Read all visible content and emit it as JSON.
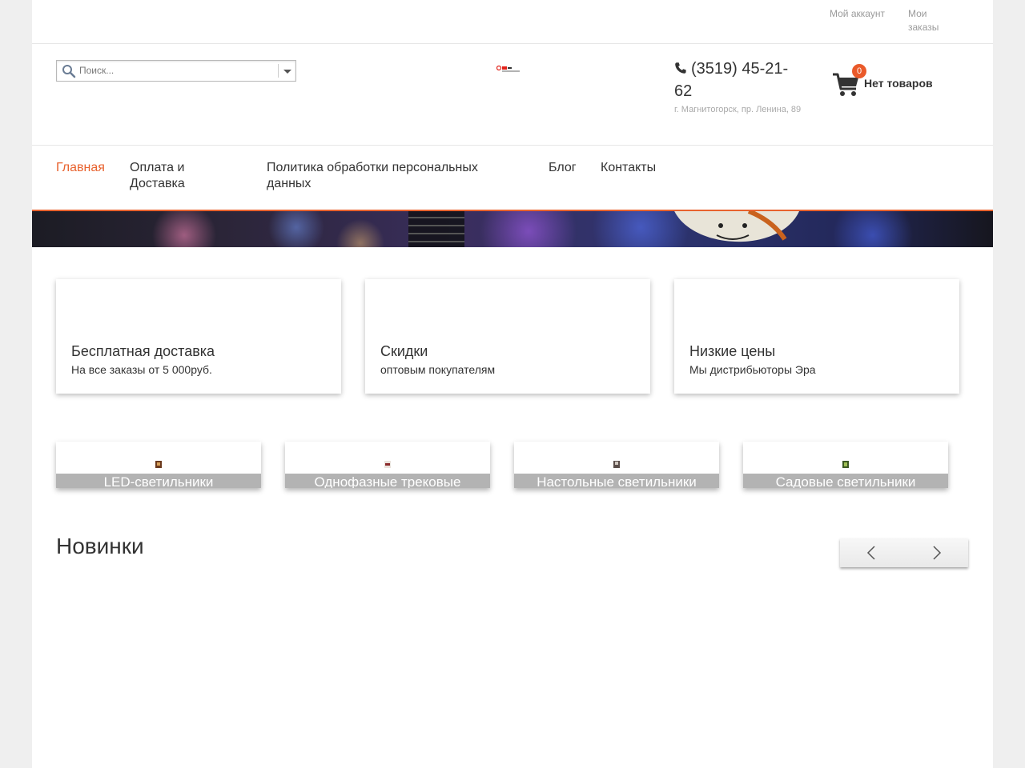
{
  "topbar": {
    "account": "Мой аккаунт",
    "orders": "Мои заказы"
  },
  "search": {
    "placeholder": "Поиск..."
  },
  "contact": {
    "phone": "(3519) 45-21-62",
    "address": "г. Магнитогорск, пр. Ленина, 89"
  },
  "cart": {
    "count": "0",
    "label": "Нет товаров"
  },
  "nav": [
    {
      "label": "Главная"
    },
    {
      "label": "Оплата и Доставка"
    },
    {
      "label": "Политика обработки персональных данных"
    },
    {
      "label": "Блог"
    },
    {
      "label": "Контакты"
    }
  ],
  "features": [
    {
      "title": "Бесплатная доставка",
      "subtitle": "На все заказы от 5 000руб."
    },
    {
      "title": "Скидки",
      "subtitle": "оптовым покупателям"
    },
    {
      "title": "Низкие цены",
      "subtitle": "Мы дистрибьюторы Эра"
    }
  ],
  "categories": [
    {
      "label": "LED-светильники"
    },
    {
      "label": "Однофазные трековые"
    },
    {
      "label": "Настольные светильники"
    },
    {
      "label": "Садовые светильники"
    }
  ],
  "section": {
    "new_title": "Новинки"
  },
  "colors": {
    "accent": "#e8622e",
    "badge": "#ea5a2a",
    "category_label_bg": "#b3b3b3"
  }
}
